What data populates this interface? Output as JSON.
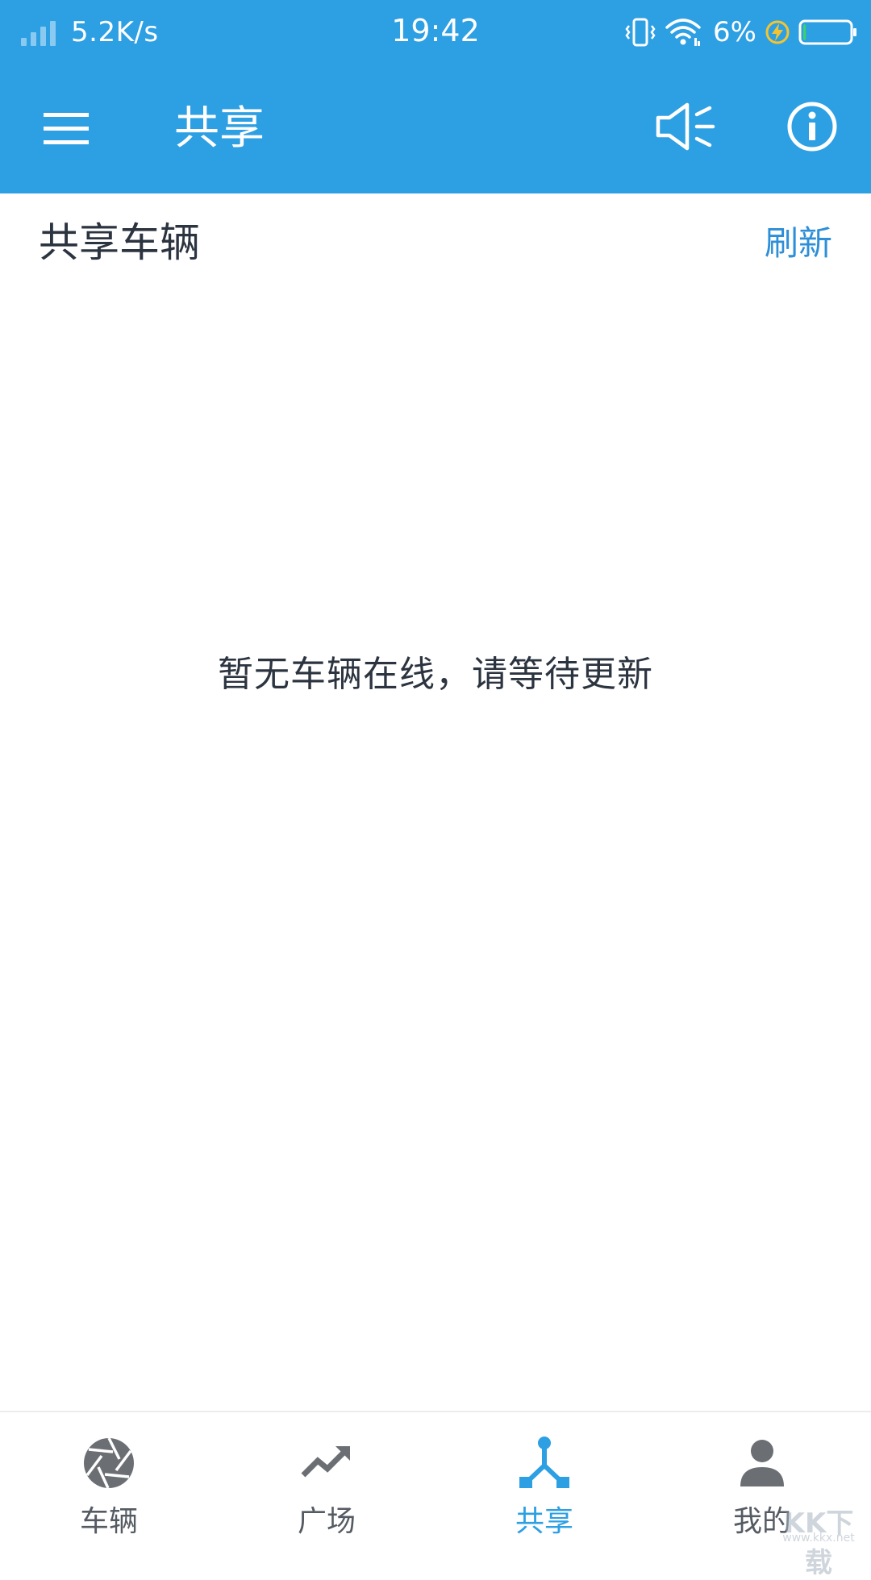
{
  "status_bar": {
    "net_speed": "5.2K/s",
    "time": "19:42",
    "battery_percent": "6%",
    "battery_level": 0.06
  },
  "app_bar": {
    "title": "共享",
    "menu_icon": "hamburger-menu-icon",
    "speaker_icon": "speaker-icon",
    "info_icon": "info-icon"
  },
  "section": {
    "title": "共享车辆",
    "refresh_label": "刷新"
  },
  "empty_state": {
    "message": "暂无车辆在线，请等待更新"
  },
  "bottom_nav": {
    "items": [
      {
        "label": "车辆",
        "icon": "aperture-icon",
        "active": false
      },
      {
        "label": "广场",
        "icon": "trending-up-icon",
        "active": false
      },
      {
        "label": "共享",
        "icon": "share-network-icon",
        "active": true
      },
      {
        "label": "我的",
        "icon": "person-icon",
        "active": false
      }
    ]
  },
  "watermark": {
    "text": "KK下载",
    "sub": "www.kkx.net"
  },
  "colors": {
    "primary": "#2D9FE3",
    "link": "#2D8FD8",
    "text_dark": "#2c3440",
    "nav_inactive": "#555b63",
    "icon_gray": "#6b6f74"
  }
}
